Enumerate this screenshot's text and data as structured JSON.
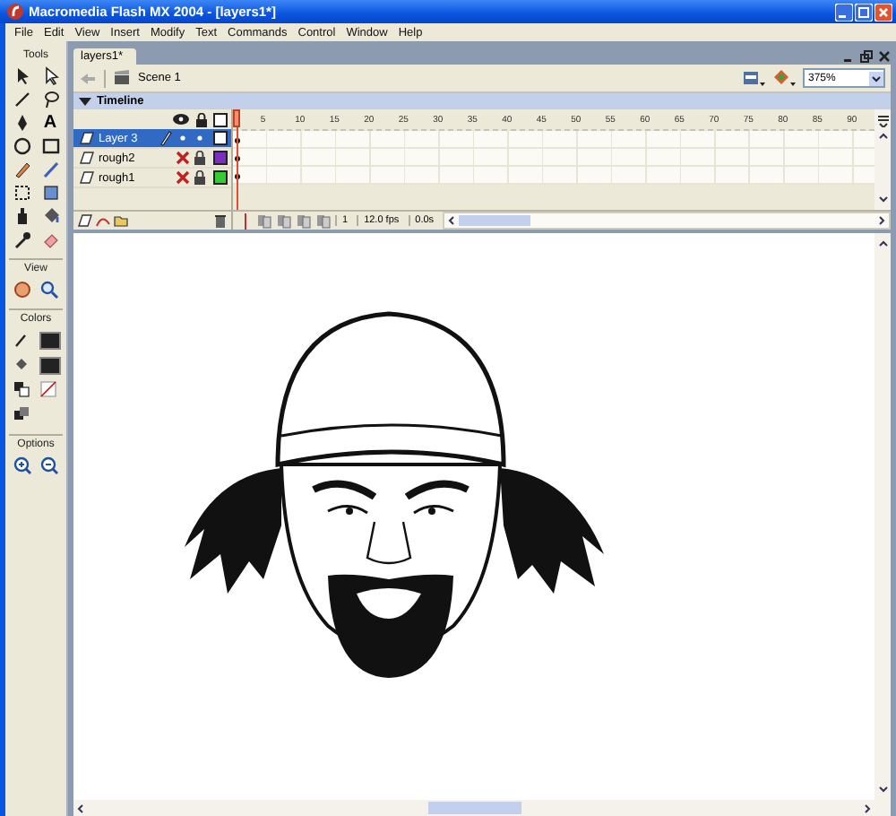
{
  "window": {
    "title": "Macromedia Flash MX 2004 - [layers1*]"
  },
  "menu": [
    "File",
    "Edit",
    "View",
    "Insert",
    "Modify",
    "Text",
    "Commands",
    "Control",
    "Window",
    "Help"
  ],
  "tools_panel": {
    "title": "Tools",
    "text_tool_glyph": "A",
    "sections": [
      {
        "title": "View"
      },
      {
        "title": "Colors"
      },
      {
        "title": "Options"
      }
    ]
  },
  "document_tab": {
    "label": "layers1*"
  },
  "scene": {
    "label": "Scene 1"
  },
  "zoom": {
    "value": "375%"
  },
  "timeline": {
    "title": "Timeline",
    "expanded": true,
    "frame_numbers": [
      "5",
      "10",
      "15",
      "20",
      "25",
      "30",
      "35",
      "40",
      "45",
      "50",
      "55",
      "60",
      "65",
      "70",
      "75",
      "80",
      "85",
      "90"
    ],
    "layers": [
      {
        "name": "Layer 3",
        "selected": true,
        "hidden": false,
        "locked": false,
        "color": "#ffffff"
      },
      {
        "name": "rough2",
        "selected": false,
        "hidden": true,
        "locked": true,
        "color": "#7b2fc0"
      },
      {
        "name": "rough1",
        "selected": false,
        "hidden": true,
        "locked": true,
        "color": "#33cc33"
      }
    ],
    "current_frame": "1",
    "frame_rate": "12.0 fps",
    "elapsed_time": "0.0s"
  }
}
